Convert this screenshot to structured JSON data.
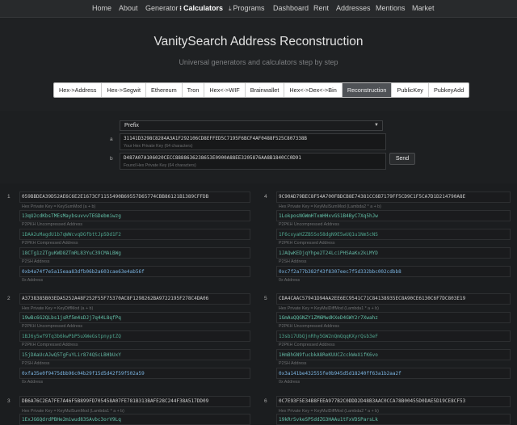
{
  "nav": {
    "items": [
      "Home",
      "About",
      "Generator",
      "Calculators",
      "Programs",
      "Dashboard",
      "Rent",
      "Addresses",
      "Mentions",
      "Market"
    ],
    "active_index": 3,
    "calculators_icon": "calculator-icon",
    "programs_icon": "download-icon"
  },
  "header": {
    "title": "VanitySearch Address Reconstruction",
    "subtitle": "Universal generators and calculators step by step"
  },
  "tabs": {
    "items": [
      "Hex->Address",
      "Hex->Segwit",
      "Ethereum",
      "Tron",
      "Hex<->WIF",
      "Brainwallet",
      "Hex<->Dex<->Bin",
      "Reconstruction",
      "PublicKey",
      "PubkeyAdd"
    ],
    "active_index": 7
  },
  "form": {
    "mode": "Prefix",
    "row_a_label": "a",
    "row_b_label": "b",
    "key_a": "31141D3298C8284A3A1F292106CD8EFFED5C7195F6BCF4AF0488F525C807338B",
    "key_a_hint": "Your Hex Private Key (64 characters)",
    "key_b": "D487A07A106020CECC8888636238653E0900A88EE3205876AA8B1840CC0D91",
    "key_b_hint": "Found Hex Private Key (64 characters)",
    "send_label": "Send"
  },
  "results": [
    {
      "num": "1",
      "key": "059BBDEA39D52AE6C6E2E1673CF1155490B69557D65774CBB86121B1389CFFDB",
      "key_hint": "Hex Private Key = KeySumMod (a + b)",
      "p2pkh_unc": "13qU2cdKbsTMEsMaybsuvvvTEGDebmiwzg",
      "p2pkh_unc_hint": "P2PKH Uncompressed Address",
      "p2pkh_cmp_alt": "1DAA2uMagdU1b7qWWcvqDGfbttJp5Dd1F2",
      "p2pkh_cmp_hint": "P2PKH Compressed Address",
      "p2pkh_cmp": "18CTg1zZTguKWD8ZTmRL83YuC39CMALBWg",
      "p2sh_hint": "P2SH Address",
      "p2sh": "0xb4a74f7e5a15eaa83dfb06b2a603cae63e4ab56f",
      "p2sh_label": "0x Address"
    },
    {
      "num": "4",
      "key": "9C90AD79BEC8F54A700FBDCB8E74381CC6B7179FF5CD9C1F5CA7D1D214790A8E",
      "key_hint": "Hex Private Key = KeyMulSumMod (Lambda2 * a + b)",
      "p2pkh_unc": "1LokposNGWmHTxmHHxvGS1B4ByC7Xq5hJw",
      "p2pkh_unc_hint": "P2PKH Uncompressed Address",
      "p2pkh_cmp_alt": "1F6cxyaHZZB5So58dgN9E5wUQ1u1Nm5cNS",
      "p2pkh_cmp_hint": "P2PKH Compressed Address",
      "p2pkh_cmp": "1JAQwKEDjqYhpe2T24LciPHSAaKx2kLMYD",
      "p2sh_hint": "P2SH Address",
      "p2sh": "0xc7f2a77b382f43f8307eec7f5d332bbc002cdbb8",
      "p2sh_label": "0x Address"
    },
    {
      "num": "2",
      "key": "A3738385B03EDA5252A48F252F55F75370AC8F1298262BA9722195F278C4DA06",
      "key_hint": "Hex Private Key = KeyDiffMod (a + b)",
      "p2pkh_unc": "19wBc6G2QLbs1jsRf5m4sDJj7q44L8qfPq",
      "p2pkh_unc_hint": "P2PKH Uncompressed Address",
      "p2pkh_cmp_alt": "1BJ6y5wf9Tq3b6kwPbP5uXWeGstpnyptZQ",
      "p2pkh_cmp_hint": "P2PKH Compressed Address",
      "p2pkh_cmp": "15jDAaUcAJwQ5TgFuYLir874QScLBHbUxY",
      "p2sh_hint": "P2SH Address",
      "p2sh": "0xfa35e0f9475dbb96c04b29f15d5d42f59f502a59",
      "p2sh_label": "0x Address"
    },
    {
      "num": "5",
      "key": "CDA4CAAC57941D94AA2EE6EC9541C71C84138935EC8A90CE6130C6F7DC803E19",
      "key_hint": "Hex Private Key = KeyMulDiffMod (Lambda1 * a + b)",
      "p2pkh_unc": "1GmAuQQGNZY1ZM6MwdKXeD4GWY2r7Xwahz",
      "p2pkh_unc_hint": "P2PKH Uncompressed Address",
      "p2pkh_cmp_alt": "13sbi7UbQjnRhy5GW2nQmQqqKXyrQsb3eF",
      "p2pkh_cmp_hint": "P2PKH Compressed Address",
      "p2pkh_cmp": "1HmBhGN9fucbkA8ReKUUCZcckWeXifK6vo",
      "p2sh_hint": "P2SH Address",
      "p2sh": "0x3a141be432555fe0b945d5d18240ff63a1b2aa2f",
      "p2sh_label": "0x Address"
    },
    {
      "num": "3",
      "key": "DB6A76C2EA7FE7A46F5B899FD705458A07FE781B313BAFE28C244F38A517DD09",
      "key_hint": "Hex Private Key = KeyMulSumMod (Lambda1 * a + b)",
      "p2pkh_unc": "1ExJG6QdrdPBHe2miwud83SAvbc3orV9Lq"
    },
    {
      "num": "6",
      "key": "0C7E93F5E34B8FEEA977B2C0DDD2D48B3AAC0CCA78B00455D0DAE5D19CE8CF53",
      "key_hint": "Hex Private Key = KeyMulDiffMod (Lambda2 * a + b)",
      "p2pkh_unc": "19kRrSvkeSP5ddZG3HAAu1tFxVDSParsLk"
    }
  ]
}
